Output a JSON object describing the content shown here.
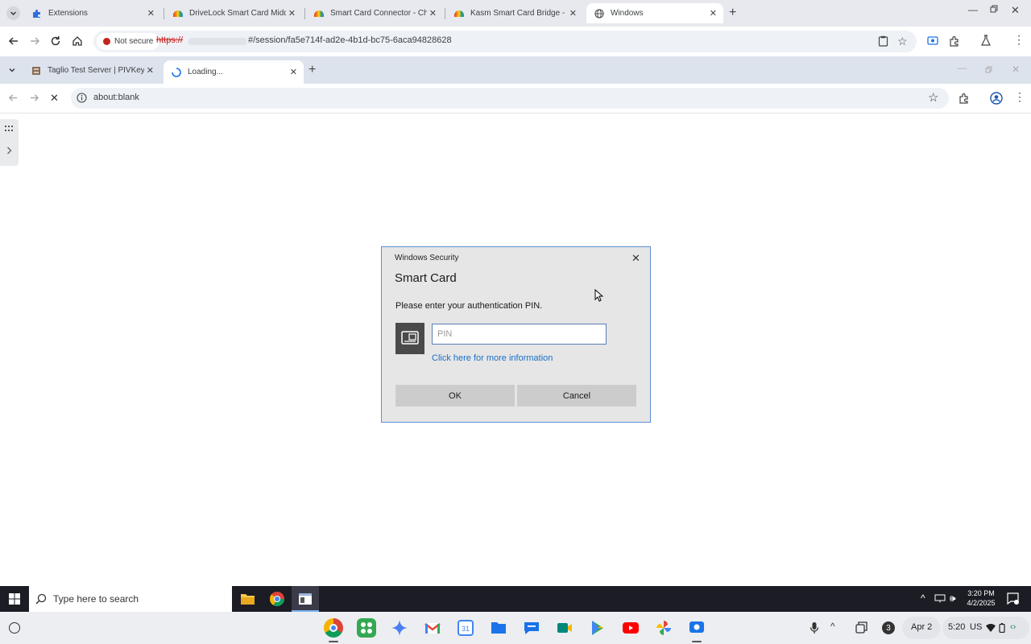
{
  "outer_browser": {
    "tabs": [
      {
        "title": "Extensions",
        "icon": "puzzle-icon"
      },
      {
        "title": "DriveLock Smart Card Middlew",
        "icon": "rainbow-icon"
      },
      {
        "title": "Smart Card Connector - Chrom",
        "icon": "rainbow-icon"
      },
      {
        "title": "Kasm Smart Card Bridge - Chro",
        "icon": "rainbow-icon"
      },
      {
        "title": "Windows",
        "icon": "globe-icon",
        "active": true
      }
    ],
    "security_chip": "Not secure",
    "url_scheme": "https://",
    "url_path": "#/session/fa5e714f-ad2e-4b1d-bc75-6aca94828628"
  },
  "inner_browser": {
    "tabs": [
      {
        "title": "Taglio Test Server | PIVKey Sma",
        "icon": "server-icon"
      },
      {
        "title": "Loading...",
        "icon": "spinner-icon",
        "active": true
      }
    ],
    "url": "about:blank"
  },
  "dialog": {
    "window_title": "Windows Security",
    "heading": "Smart Card",
    "prompt": "Please enter your authentication PIN.",
    "pin_placeholder": "PIN",
    "more_info_link": "Click here for more information",
    "ok_label": "OK",
    "cancel_label": "Cancel"
  },
  "windows_taskbar": {
    "search_placeholder": "Type here to search",
    "time": "3:20 PM",
    "date": "4/2/2025"
  },
  "chromeos_shelf": {
    "date": "Apr 2",
    "time": "5:20",
    "region": "US",
    "notification_count": "3"
  },
  "colors": {
    "link": "#1a6fc9",
    "not_secure": "#c5221f",
    "dialog_border": "#5b8fd4",
    "taskbar": "#1c1c25"
  }
}
